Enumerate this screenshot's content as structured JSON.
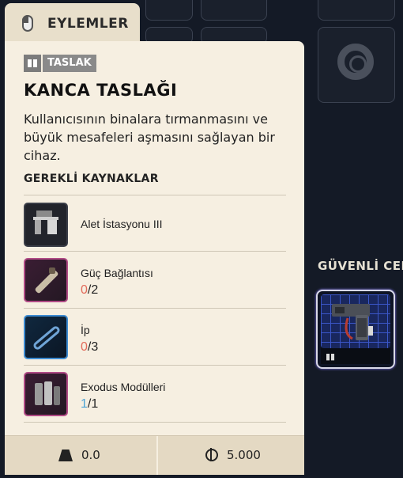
{
  "actions_tab": {
    "label": "EYLEMLER",
    "icon": "mouse-icon"
  },
  "item": {
    "tag": "TASLAK",
    "tag_icon": "book-icon",
    "title": "KANCA TASLAĞI",
    "description": "Kullanıcısının binalara tırmanmasını ve büyük mesafeleri aşmasını sağlayan bir cihaz."
  },
  "requirements": {
    "title": "GEREKLİ KAYNAKLAR",
    "items": [
      {
        "name": "Alet İstasyonu III",
        "icon": "workbench-icon",
        "have": "",
        "need": ""
      },
      {
        "name": "Güç Bağlantısı",
        "icon": "power-rod-icon",
        "have": "0",
        "need": "/2"
      },
      {
        "name": "İp",
        "icon": "rope-icon",
        "have": "0",
        "need": "/3"
      },
      {
        "name": "Exodus Modülleri",
        "icon": "modules-icon",
        "have": "1",
        "need": "/1"
      }
    ]
  },
  "footer": {
    "weight": "0.0",
    "price": "5.000"
  },
  "safe_pocket": {
    "label": "GÜVENLİ CEP"
  },
  "colors": {
    "panel_bg": "#f6efe1",
    "missing": "#e26b5a",
    "owned": "#4aa3d6",
    "background": "#141a26"
  }
}
